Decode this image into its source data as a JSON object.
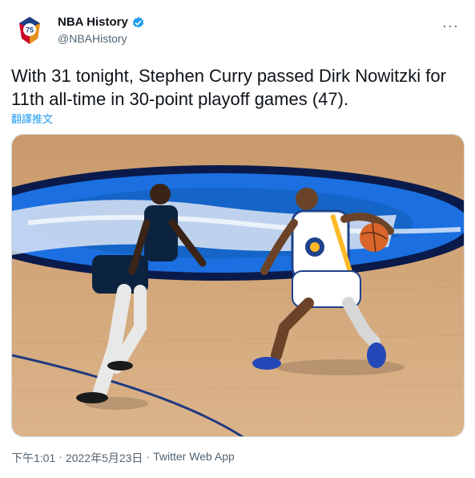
{
  "account": {
    "name": "NBA History",
    "handle": "@NBAHistory",
    "verified": true,
    "avatar_icon": "nba-75-logo"
  },
  "menu": {
    "more_label": "···"
  },
  "tweet": {
    "text": "With 31 tonight, Stephen Curry passed Dirk Nowitzki for 11th all-time in 30-point playoff games (47).",
    "translate_label": "翻譯推文"
  },
  "media": {
    "description_icon": "basketball-photo"
  },
  "meta": {
    "time": "下午1:01",
    "separator": "·",
    "date": "2022年5月23日",
    "source": "Twitter Web App"
  },
  "colors": {
    "link": "#1d9bf0",
    "secondary_text": "#536471",
    "verified": "#1d9bf0"
  }
}
